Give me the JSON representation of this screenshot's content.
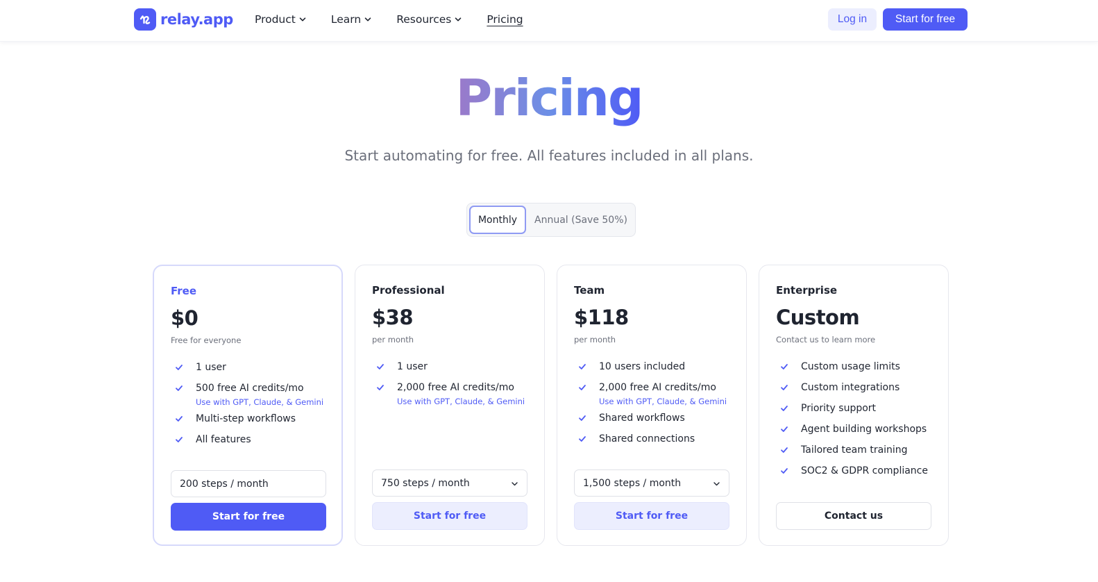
{
  "header": {
    "logo_text": "relay.app",
    "nav": [
      {
        "label": "Product",
        "dropdown": true
      },
      {
        "label": "Learn",
        "dropdown": true
      },
      {
        "label": "Resources",
        "dropdown": true
      },
      {
        "label": "Pricing",
        "dropdown": false,
        "active": true
      }
    ],
    "login_label": "Log in",
    "start_label": "Start for free"
  },
  "hero": {
    "title": "Pricing",
    "subtitle": "Start automating for free. All features included in all plans."
  },
  "billing_toggle": {
    "options": [
      "Monthly",
      "Annual (Save 50%)"
    ],
    "selected": "Monthly"
  },
  "plans": [
    {
      "name": "Free",
      "price": "$0",
      "price_sub": "Free for everyone",
      "features": [
        {
          "text": "1 user",
          "note": ""
        },
        {
          "text": "500 free AI credits/mo",
          "note": "Use with GPT, Claude, & Gemini"
        },
        {
          "text": "Multi-step workflows",
          "note": ""
        },
        {
          "text": "All features",
          "note": ""
        }
      ],
      "steps": "200 steps / month",
      "cta": "Start for free"
    },
    {
      "name": "Professional",
      "price": "$38",
      "price_sub": "per month",
      "features": [
        {
          "text": "1 user",
          "note": ""
        },
        {
          "text": "2,000 free AI credits/mo",
          "note": "Use with GPT, Claude, & Gemini"
        }
      ],
      "steps": "750 steps / month",
      "cta": "Start for free"
    },
    {
      "name": "Team",
      "price": "$118",
      "price_sub": "per month",
      "features": [
        {
          "text": "10 users included",
          "note": ""
        },
        {
          "text": "2,000 free AI credits/mo",
          "note": "Use with GPT, Claude, & Gemini"
        },
        {
          "text": "Shared workflows",
          "note": ""
        },
        {
          "text": "Shared connections",
          "note": ""
        }
      ],
      "steps": "1,500 steps / month",
      "cta": "Start for free"
    },
    {
      "name": "Enterprise",
      "price": "Custom",
      "price_sub": "Contact us to learn more",
      "features": [
        {
          "text": "Custom usage limits",
          "note": ""
        },
        {
          "text": "Custom integrations",
          "note": ""
        },
        {
          "text": "Priority support",
          "note": ""
        },
        {
          "text": "Agent building workshops",
          "note": ""
        },
        {
          "text": "Tailored team training",
          "note": ""
        },
        {
          "text": "SOC2 & GDPR compliance",
          "note": ""
        }
      ],
      "steps": "",
      "cta": "Contact us"
    }
  ],
  "colors": {
    "brand": "#4f5bf5",
    "brand_soft": "#eceefe",
    "text": "#1f2430",
    "muted": "#6b6f7b",
    "gradient_start": "#9b79c9"
  }
}
